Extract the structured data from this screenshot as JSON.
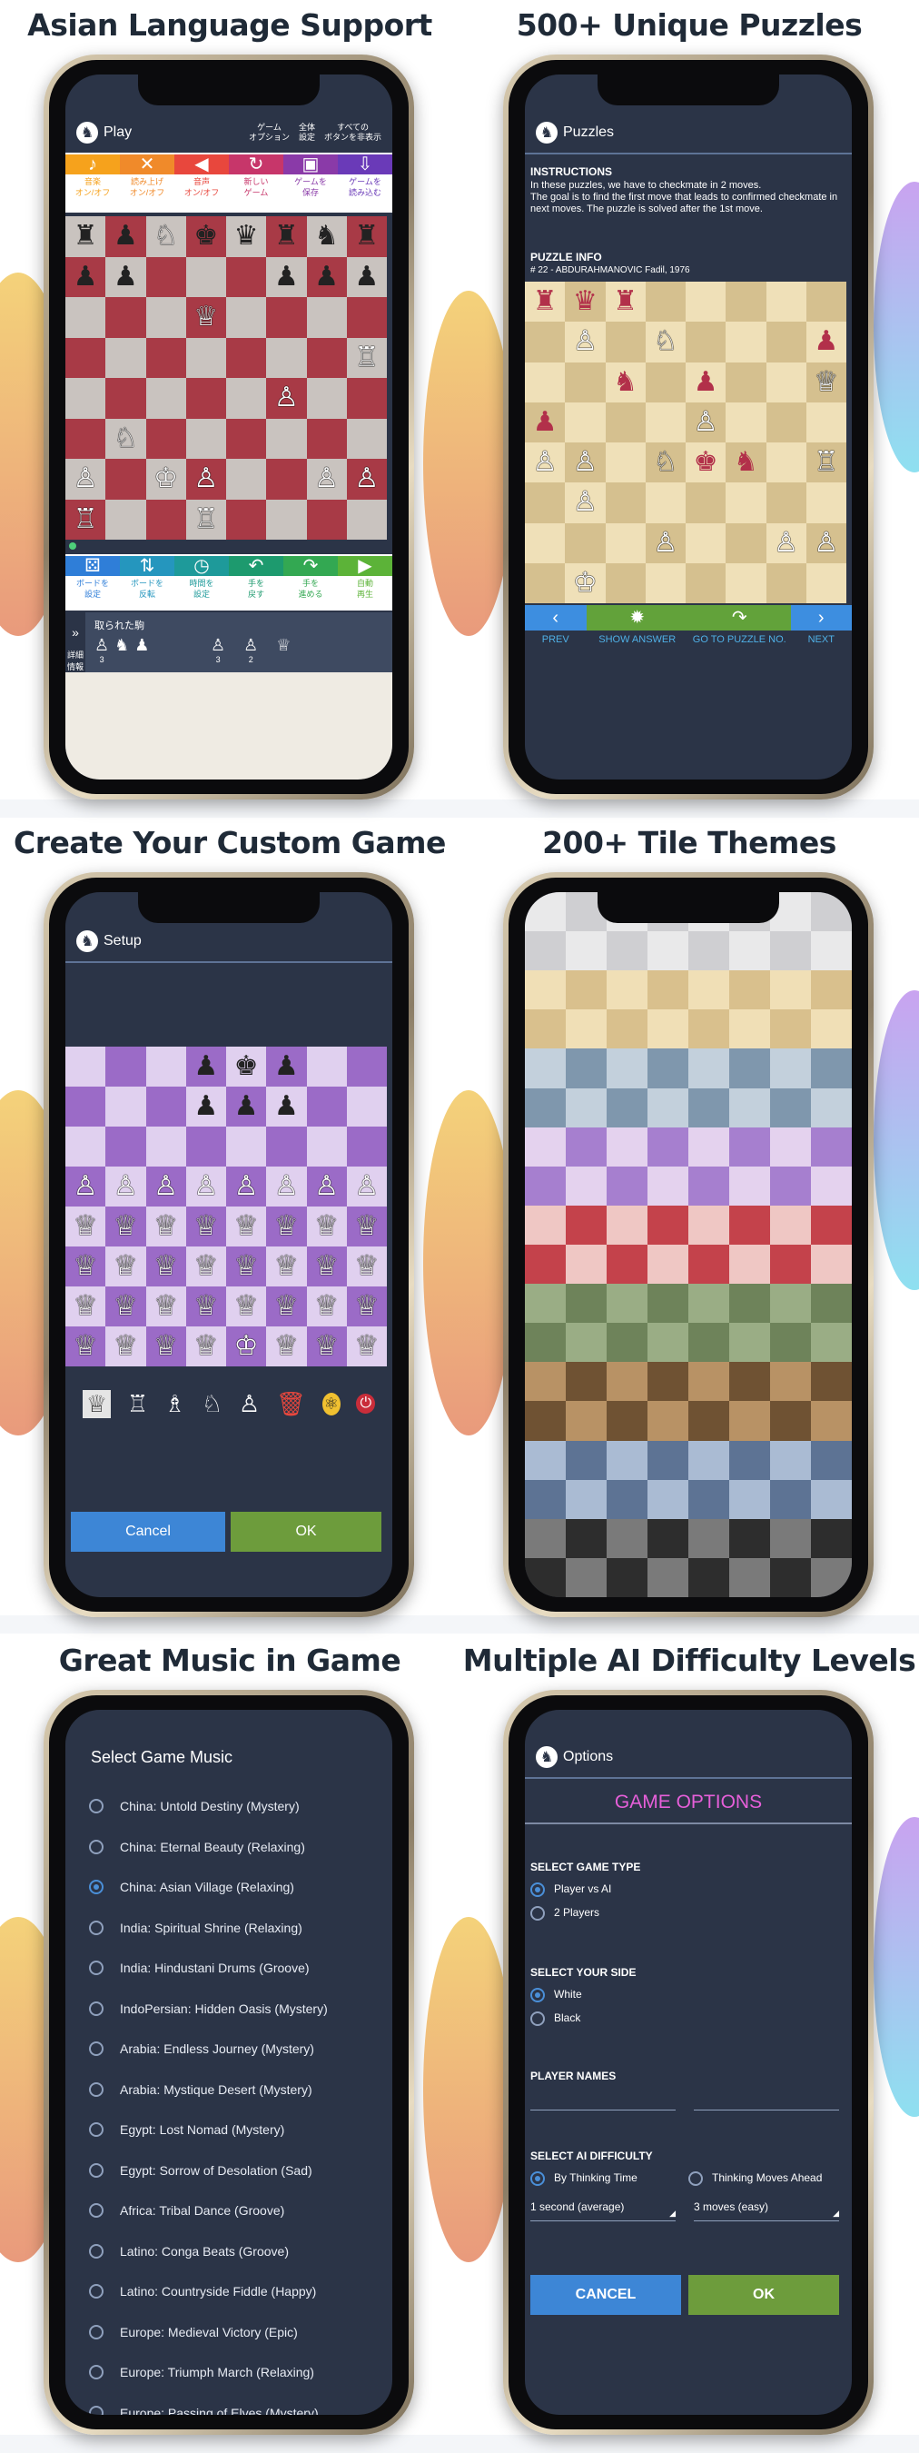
{
  "headings": {
    "p1": "Asian Language Support",
    "p2": "500+ Unique Puzzles",
    "p3": "Create Your Custom Game",
    "p4": "200+ Tile Themes",
    "p5": "Great Music in Game",
    "p6": "Multiple AI Difficulty Levels"
  },
  "play": {
    "title": "Play",
    "logo_icon": "chess-knight-icon",
    "menu": [
      "ゲーム\nオプション",
      "全体\n設定",
      "すべての\nボタンを非表示"
    ],
    "toolbar_top": [
      {
        "icon": "♪",
        "label": "音楽\nオン/オフ",
        "color": "#f6a21c"
      },
      {
        "icon": "✕",
        "label": "読み上げ\nオン/オフ",
        "color": "#f08a2a"
      },
      {
        "icon": "◀",
        "label": "音声\nオン/オフ",
        "color": "#e8473d"
      },
      {
        "icon": "↻",
        "label": "新しい\nゲーム",
        "color": "#c7366a"
      },
      {
        "icon": "▣",
        "label": "ゲームを\n保存",
        "color": "#8a3aa8"
      },
      {
        "icon": "⇩",
        "label": "ゲームを\n読み込む",
        "color": "#6a3ab8"
      }
    ],
    "toolbar_bottom": [
      {
        "icon": "⚄",
        "label": "ボードを\n設定",
        "color": "#2f7ed8"
      },
      {
        "icon": "⇅",
        "label": "ボードを\n反転",
        "color": "#2596be"
      },
      {
        "icon": "◷",
        "label": "時間を\n設定",
        "color": "#1e9a9a"
      },
      {
        "icon": "↶",
        "label": "手を\n戻す",
        "color": "#1d9a6e"
      },
      {
        "icon": "↷",
        "label": "手を\n進める",
        "color": "#33a852"
      },
      {
        "icon": "▶",
        "label": "自動\n再生",
        "color": "#5cb338"
      }
    ],
    "side_label": "詳細\n情報",
    "captured_title": "取られた駒",
    "captured_left": [
      "♙",
      "♞",
      "♟"
    ],
    "captured_left_counts": [
      "3",
      "",
      ""
    ],
    "captured_right": [
      "♙",
      "♙",
      "♕"
    ],
    "captured_right_counts": [
      "3",
      "2",
      ""
    ],
    "board": [
      [
        "♜",
        "♟",
        "♘",
        "♚",
        "♛",
        "♜",
        "♞",
        "♜"
      ],
      [
        "♟",
        "♟",
        "",
        "",
        "",
        "♟",
        "♟",
        "♟"
      ],
      [
        "",
        "",
        "",
        "♕",
        "",
        "",
        "",
        ""
      ],
      [
        "",
        "",
        "",
        "",
        "",
        "",
        "",
        "♖"
      ],
      [
        "",
        "",
        "",
        "",
        "",
        "♙",
        "",
        ""
      ],
      [
        "",
        "♘",
        "",
        "",
        "",
        "",
        "",
        ""
      ],
      [
        "♙",
        "",
        "♔",
        "♙",
        "",
        "",
        "♙",
        "♙"
      ],
      [
        "♖",
        "",
        "",
        "♖",
        "",
        "",
        "",
        ""
      ]
    ],
    "colors": {
      "light": "#c9c3bf",
      "dark": "#a83a46"
    }
  },
  "puzzles": {
    "title": "Puzzles",
    "instructions_title": "INSTRUCTIONS",
    "instructions_text": "In these puzzles, we have to checkmate in 2 moves.\nThe goal is to find the first move that leads to confirmed checkmate in next moves. The puzzle is solved after the 1st move.",
    "info_title": "PUZZLE INFO",
    "info_text": "# 22 - ABDURAHMANOVIC Fadil, 1976",
    "board": [
      [
        "♜",
        "♛",
        "♜",
        "",
        "",
        "",
        "",
        ""
      ],
      [
        "",
        "♙",
        "",
        "♘",
        "",
        "",
        "",
        "♟"
      ],
      [
        "",
        "",
        "♞",
        "",
        "♟",
        "",
        "",
        "♕"
      ],
      [
        "♟",
        "",
        "",
        "",
        "♙",
        "",
        "",
        ""
      ],
      [
        "♙",
        "♙",
        "",
        "♘",
        "♚",
        "♞",
        "",
        "♖"
      ],
      [
        "",
        "♙",
        "",
        "",
        "",
        "",
        "",
        ""
      ],
      [
        "",
        "",
        "",
        "♙",
        "",
        "",
        "♙",
        "♙"
      ],
      [
        "",
        "♔",
        "",
        "",
        "",
        "",
        "",
        ""
      ]
    ],
    "colors": {
      "light": "#efe0b8",
      "dark": "#d5c08f"
    },
    "nav": [
      {
        "icon": "‹",
        "label": "PREV"
      },
      {
        "icon": "✹",
        "label": "SHOW ANSWER"
      },
      {
        "icon": "↷",
        "label": "GO TO PUZZLE NO."
      },
      {
        "icon": "›",
        "label": "NEXT"
      }
    ]
  },
  "setup": {
    "title": "Setup",
    "board": [
      [
        "",
        "",
        "",
        "♟",
        "♚",
        "♟",
        "",
        ""
      ],
      [
        "",
        "",
        "",
        "♟",
        "♟",
        "♟",
        "",
        ""
      ],
      [
        "",
        "",
        "",
        "",
        "",
        "",
        "",
        ""
      ],
      [
        "♙",
        "♙",
        "♙",
        "♙",
        "♙",
        "♙",
        "♙",
        "♙"
      ],
      [
        "♕",
        "♕",
        "♕",
        "♕",
        "♕",
        "♕",
        "♕",
        "♕"
      ],
      [
        "♕",
        "♕",
        "♕",
        "♕",
        "♕",
        "♕",
        "♕",
        "♕"
      ],
      [
        "♕",
        "♕",
        "♕",
        "♕",
        "♕",
        "♕",
        "♕",
        "♕"
      ],
      [
        "♕",
        "♕",
        "♕",
        "♕",
        "♔",
        "♕",
        "♕",
        "♕"
      ]
    ],
    "colors": {
      "light": "#e0d0ef",
      "dark": "#9b6bc7"
    },
    "palette": [
      "♕",
      "♖",
      "♗",
      "♘",
      "♙",
      "🗑",
      "⚛",
      "⏻"
    ],
    "cancel": "Cancel",
    "ok": "OK"
  },
  "themes": {
    "rows": [
      [
        "#e9e9ea",
        "#cfcfd2"
      ],
      [
        "#f0dfb6",
        "#d9c08d"
      ],
      [
        "#c3d0dc",
        "#7f97ad"
      ],
      [
        "#e4d2ee",
        "#a67fcf"
      ],
      [
        "#efc7c4",
        "#c4424b"
      ],
      [
        "#9aad85",
        "#6e835a"
      ],
      [
        "#b89265",
        "#6f5233"
      ],
      [
        "#aabbd3",
        "#5d7394"
      ],
      [
        "#7a7a7a",
        "#2d2d2d"
      ]
    ]
  },
  "music": {
    "title": "Select Game Music",
    "selected": 2,
    "tracks": [
      "China: Untold Destiny (Mystery)",
      "China: Eternal Beauty (Relaxing)",
      "China: Asian Village (Relaxing)",
      "India: Spiritual Shrine (Relaxing)",
      "India: Hindustani Drums (Groove)",
      "IndoPersian: Hidden Oasis (Mystery)",
      "Arabia: Endless Journey (Mystery)",
      "Arabia: Mystique Desert (Mystery)",
      "Egypt: Lost Nomad (Mystery)",
      "Egypt: Sorrow of Desolation (Sad)",
      "Africa: Tribal Dance (Groove)",
      "Latino: Conga Beats (Groove)",
      "Latino: Countryside Fiddle (Happy)",
      "Europe: Medieval Victory (Epic)",
      "Europe: Triumph March (Relaxing)",
      "Europe: Passing of Elves (Mystery)"
    ]
  },
  "options": {
    "title": "Options",
    "header": "GAME OPTIONS",
    "game_type_label": "SELECT GAME TYPE",
    "game_type": [
      "Player vs AI",
      "2 Players"
    ],
    "side_label": "SELECT YOUR SIDE",
    "side": [
      "White",
      "Black"
    ],
    "names_label": "PLAYER NAMES",
    "ai_label": "SELECT AI DIFFICULTY",
    "ai_mode": [
      "By Thinking Time",
      "Thinking Moves Ahead"
    ],
    "ai_values": [
      "1 second (average)",
      "3 moves (easy)"
    ],
    "cancel": "CANCEL",
    "ok": "OK",
    "accent": "#e65fd9"
  }
}
